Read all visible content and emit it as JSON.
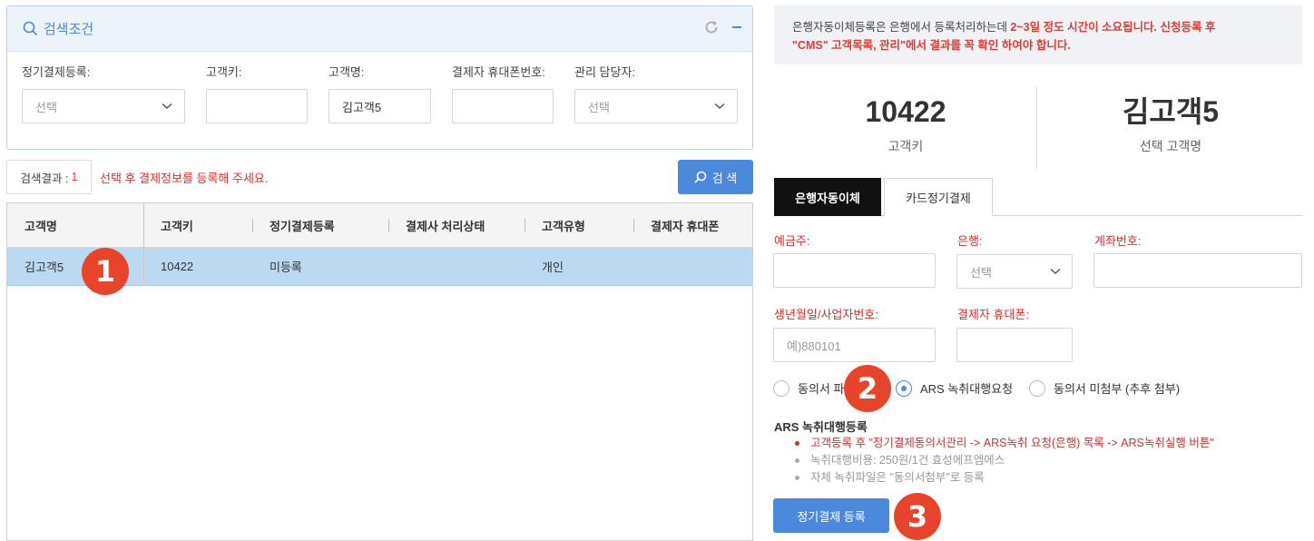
{
  "search": {
    "title": "검색조건",
    "fields": [
      {
        "label": "정기결제등록:",
        "value": "선택",
        "type": "select"
      },
      {
        "label": "고객키:",
        "value": "",
        "type": "input"
      },
      {
        "label": "고객명:",
        "value": "김고객5",
        "type": "input"
      },
      {
        "label": "결제자 휴대폰번호:",
        "value": "",
        "type": "input"
      },
      {
        "label": "관리 담당자:",
        "value": "선택",
        "type": "select"
      }
    ]
  },
  "results": {
    "count_label": "검색결과 :",
    "count": "1",
    "message": "선택 후 결제정보를 등록해 주세요.",
    "search_button": "검 색"
  },
  "table": {
    "headers": [
      "고객명",
      "고객키",
      "정기결제등록",
      "결제사 처리상태",
      "고객유형",
      "결제자 휴대폰"
    ],
    "rows": [
      [
        "김고객5",
        "10422",
        "미등록",
        "",
        "개인",
        ""
      ]
    ]
  },
  "notice": {
    "text1": "은행자동이체등록은 은행에서 등록처리하는데 ",
    "highlight1": "2~3일 정도 시간이 소요됩니다. 신청등록 후",
    "highlight2": "\"CMS\" 고객목록, 관리\"에서 결과를 꼭 확인 하여야 합니다."
  },
  "summary": {
    "customer_key": "10422",
    "customer_key_label": "고객키",
    "customer_name": "김고객5",
    "customer_name_label": "선택 고객명"
  },
  "tabs": [
    "은행자동이체",
    "카드정기결제"
  ],
  "form": {
    "depositor_label": "예금주:",
    "bank_label": "은행:",
    "bank_value": "선택",
    "account_label": "계좌번호:",
    "birth_label": "생년월일/사업자번호:",
    "birth_placeholder": "예)880101",
    "phone_label": "결제자 휴대폰:",
    "radio_options": [
      "동의서 파일",
      "ARS 녹취대행요청",
      "동의서 미첨부 (추후 첨부)"
    ],
    "radio_selected": 1
  },
  "ars": {
    "title": "ARS 녹취대행등록",
    "items": [
      "고객등록 후 \"정기결제동의서관리 -> ARS녹취 요청(은행) 목록 -> ARS녹취실행 버튼\"",
      "녹취대행비용: 250원/1건 효성에프엠에스",
      "자체 녹취파일은 \"동의서첨부\"로 등록"
    ]
  },
  "register_button": "정기결제 등록",
  "badges": [
    "1",
    "2",
    "3"
  ],
  "colors": {
    "accent": "#4a89dc",
    "alert": "#d32f2f",
    "badge": "#e8442b",
    "selected_row": "#bcd9f2"
  }
}
